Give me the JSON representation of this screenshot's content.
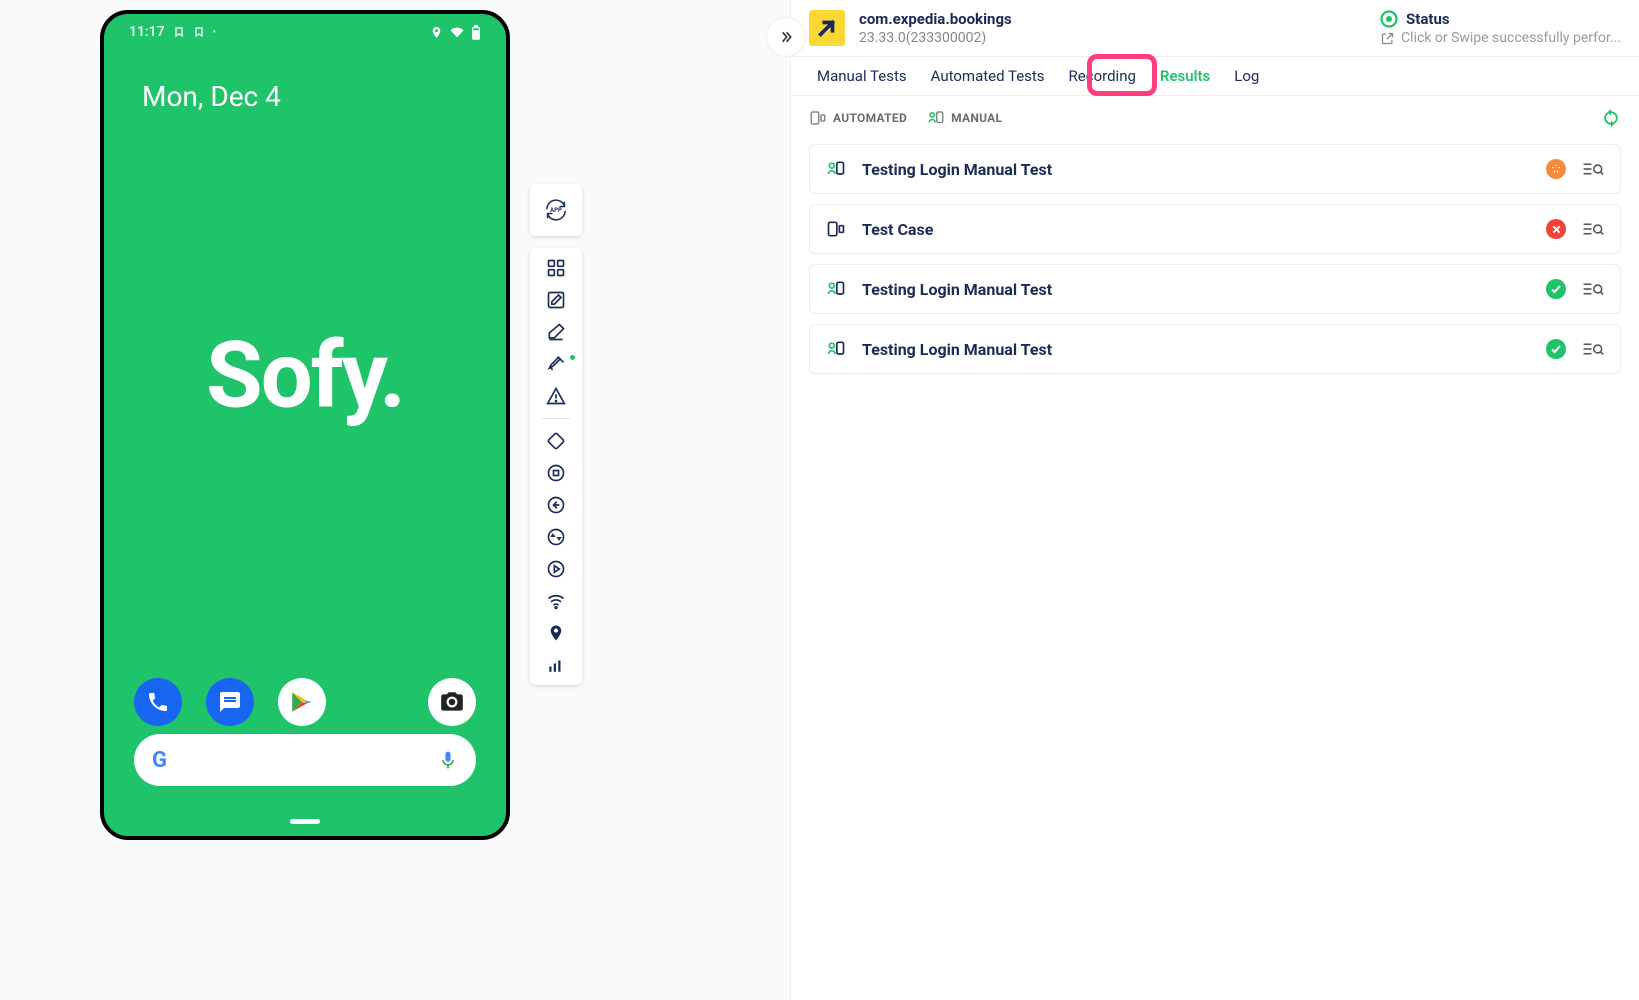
{
  "phone": {
    "time": "11:17",
    "date": "Mon, Dec 4",
    "logo": "Sofy."
  },
  "app_button": "APP",
  "header": {
    "app_name": "com.expedia.bookings",
    "version": "23.33.0(233300002)",
    "status_label": "Status",
    "status_message": "Click or Swipe successfully perfor..."
  },
  "tabs": {
    "manual": "Manual Tests",
    "automated": "Automated Tests",
    "recording": "Recording",
    "results": "Results",
    "log": "Log"
  },
  "filters": {
    "automated": "AUTOMATED",
    "manual": "MANUAL"
  },
  "results": [
    {
      "type": "manual",
      "title": "Testing Login Manual Test",
      "status": "orange"
    },
    {
      "type": "automated",
      "title": "Test Case",
      "status": "red"
    },
    {
      "type": "manual",
      "title": "Testing Login Manual Test",
      "status": "green"
    },
    {
      "type": "manual",
      "title": "Testing Login Manual Test",
      "status": "green"
    }
  ]
}
